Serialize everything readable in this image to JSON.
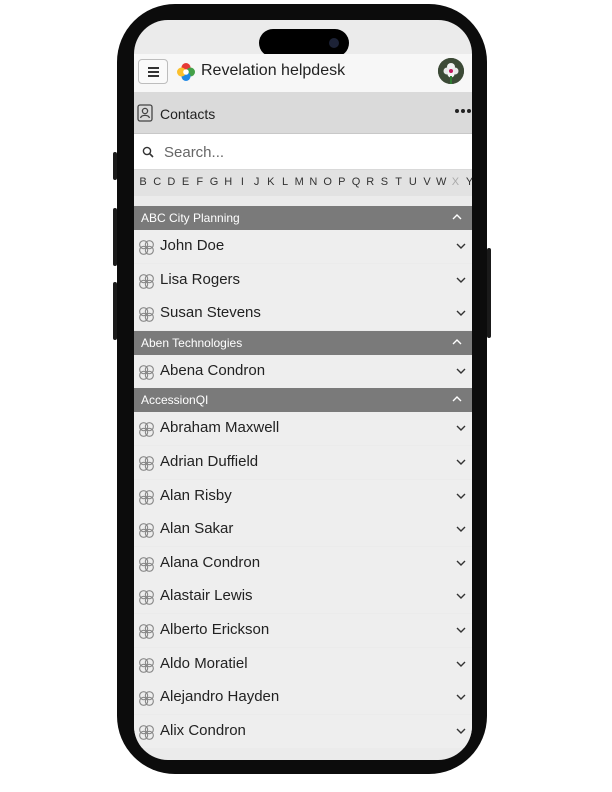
{
  "app": {
    "title": "Revelation helpdesk"
  },
  "header": {
    "title": "Contacts"
  },
  "search": {
    "placeholder": "Search..."
  },
  "alphabet": [
    {
      "ch": "B",
      "dim": false
    },
    {
      "ch": "C",
      "dim": false
    },
    {
      "ch": "D",
      "dim": false
    },
    {
      "ch": "E",
      "dim": false
    },
    {
      "ch": "F",
      "dim": false
    },
    {
      "ch": "G",
      "dim": false
    },
    {
      "ch": "H",
      "dim": false
    },
    {
      "ch": "I",
      "dim": false
    },
    {
      "ch": "J",
      "dim": false
    },
    {
      "ch": "K",
      "dim": false
    },
    {
      "ch": "L",
      "dim": false
    },
    {
      "ch": "M",
      "dim": false
    },
    {
      "ch": "N",
      "dim": false
    },
    {
      "ch": "O",
      "dim": false
    },
    {
      "ch": "P",
      "dim": false
    },
    {
      "ch": "Q",
      "dim": false
    },
    {
      "ch": "R",
      "dim": false
    },
    {
      "ch": "S",
      "dim": false
    },
    {
      "ch": "T",
      "dim": false
    },
    {
      "ch": "U",
      "dim": false
    },
    {
      "ch": "V",
      "dim": false
    },
    {
      "ch": "W",
      "dim": false
    },
    {
      "ch": "X",
      "dim": true
    },
    {
      "ch": "Y",
      "dim": false
    }
  ],
  "groups": [
    {
      "name": "ABC City Planning",
      "contacts": [
        "John Doe",
        "Lisa Rogers",
        "Susan Stevens"
      ]
    },
    {
      "name": "Aben Technologies",
      "contacts": [
        "Abena Condron"
      ]
    },
    {
      "name": "AccessionQI",
      "contacts": [
        "Abraham Maxwell",
        "Adrian Duffield",
        "Alan Risby",
        "Alan Sakar",
        "Alana Condron",
        "Alastair Lewis",
        "Alberto Erickson",
        "Aldo Moratiel",
        "Alejandro Hayden",
        "Alix Condron"
      ]
    }
  ],
  "icons": {
    "menu": "hamburger-icon",
    "logo": "revelation-logo",
    "avatar": "user-avatar",
    "contacts": "contact-card-icon",
    "more": "more-options-icon",
    "search": "search-icon",
    "contact_row": "contact-person-icon",
    "expand": "chevron-down-icon",
    "collapse": "chevron-up-icon"
  },
  "colors": {
    "group_header_bg": "#7a7a7a",
    "row_bg": "#eeeeee",
    "header_bg": "#dadada",
    "appbar_bg": "#f7f7f7"
  }
}
